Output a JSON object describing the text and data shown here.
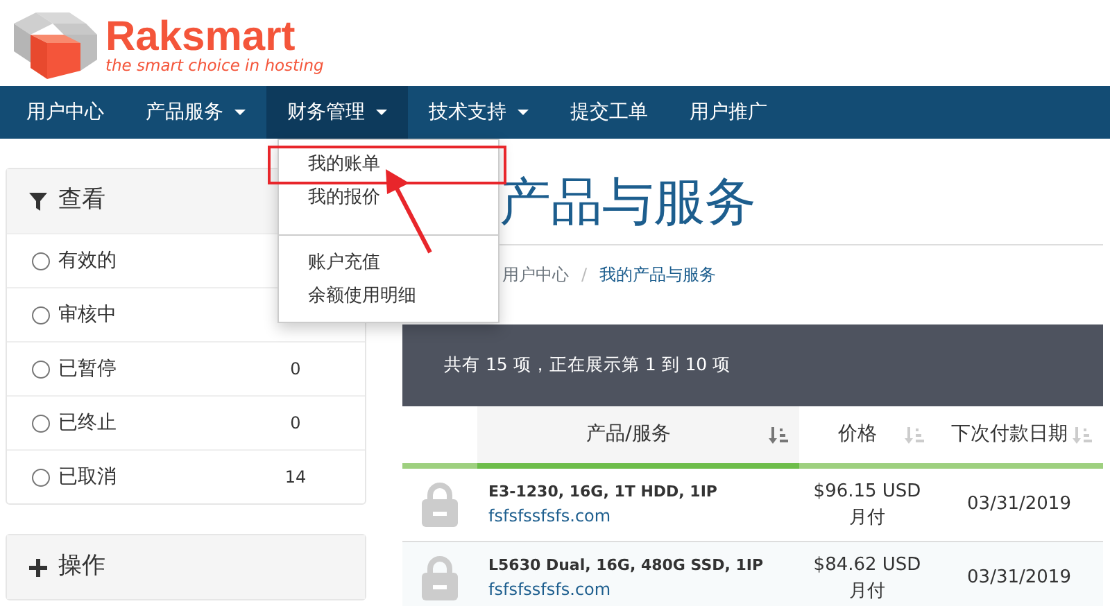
{
  "logo": {
    "name": "Raksmart",
    "tagline": "the smart choice in hosting"
  },
  "nav": [
    {
      "label": "用户中心",
      "dropdown": false,
      "selected": false
    },
    {
      "label": "产品服务",
      "dropdown": true,
      "selected": false
    },
    {
      "label": "财务管理",
      "dropdown": true,
      "selected": true
    },
    {
      "label": "技术支持",
      "dropdown": true,
      "selected": false
    },
    {
      "label": "提交工单",
      "dropdown": false,
      "selected": false
    },
    {
      "label": "用户推广",
      "dropdown": false,
      "selected": false
    }
  ],
  "dropdown_menu": {
    "groups": [
      [
        {
          "label": "我的账单",
          "highlighted": true
        },
        {
          "label": "我的报价",
          "highlighted": false
        }
      ],
      [
        {
          "label": "账户充值",
          "highlighted": false
        },
        {
          "label": "余额使用明细",
          "highlighted": false
        }
      ]
    ]
  },
  "sidebar": {
    "filter_panel": {
      "title": "查看",
      "items": [
        {
          "label": "有效的",
          "checked": false
        },
        {
          "label": "审核中",
          "checked": false
        },
        {
          "label": "已暂停",
          "checked": false,
          "count": "0"
        },
        {
          "label": "已终止",
          "checked": false,
          "count": "0"
        },
        {
          "label": "已取消",
          "checked": false,
          "count": "14"
        }
      ]
    },
    "actions_panel": {
      "title": "操作"
    }
  },
  "page_title": "产品与服务",
  "breadcrumb": {
    "separator": "/",
    "items": [
      {
        "label": "用户中心",
        "current": false
      },
      {
        "label": "我的产品与服务",
        "current": true
      }
    ]
  },
  "table": {
    "summary": "共有 15 项，正在展示第 1 到 10 项",
    "columns": [
      {
        "label": "产品/服务",
        "sorted": true
      },
      {
        "label": "价格",
        "sorted": false
      },
      {
        "label": "下次付款日期",
        "sorted": false
      }
    ],
    "rows": [
      {
        "product": "E3-1230, 16G, 1T HDD, 1IP",
        "domain": "fsfsfssfsfs.com",
        "price": "$96.15 USD",
        "cycle": "月付",
        "next_due": "03/31/2019"
      },
      {
        "product": "L5630 Dual, 16G, 480G SSD, 1IP",
        "domain": "fsfsfssfsfs.com",
        "price": "$84.62 USD",
        "cycle": "月付",
        "next_due": "03/31/2019"
      }
    ]
  }
}
